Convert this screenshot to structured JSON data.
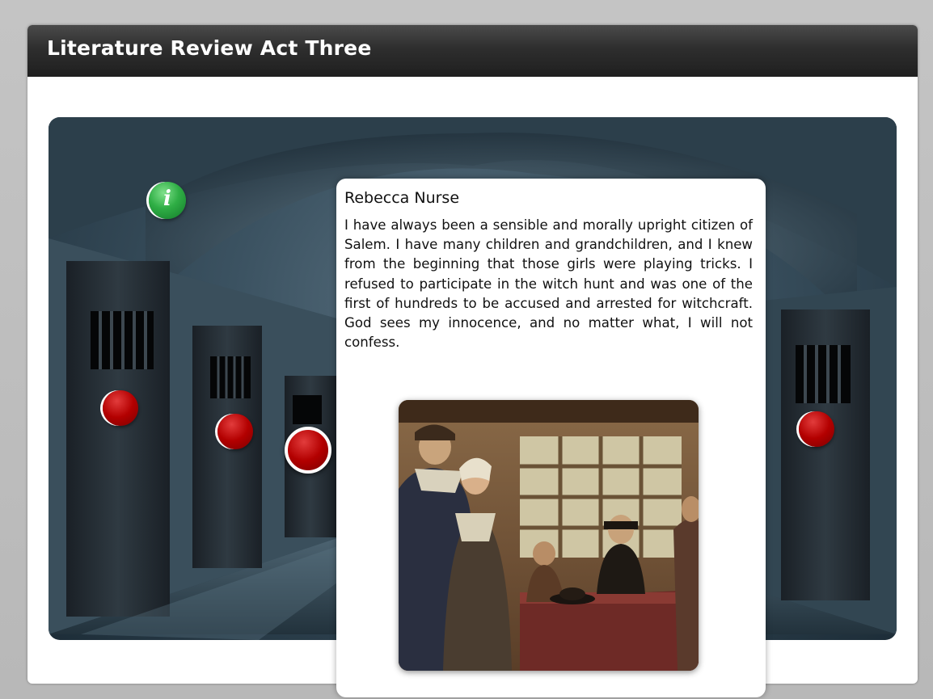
{
  "window": {
    "title": "Literature Review Act Three"
  },
  "scene": {
    "info_button": {
      "label": "i",
      "icon": "info-icon",
      "color": "#2fae45"
    },
    "hotspot_color": "#b30000",
    "hotspots": [
      {
        "name": "cell-door-1",
        "active": false
      },
      {
        "name": "cell-door-2",
        "active": false
      },
      {
        "name": "cell-door-3",
        "active": true
      },
      {
        "name": "cell-door-4",
        "active": false
      }
    ]
  },
  "popup": {
    "name": "Rebecca Nurse",
    "text": "I have always been a sensible and morally upright citizen of Salem. I have many children and grandchildren, and I knew from the beginning that those girls were playing tricks. I refused to participate in the witch hunt and was one of the first of hundreds to be accused and arrested for witchcraft. God sees my innocence, and no matter what, I will not confess."
  }
}
